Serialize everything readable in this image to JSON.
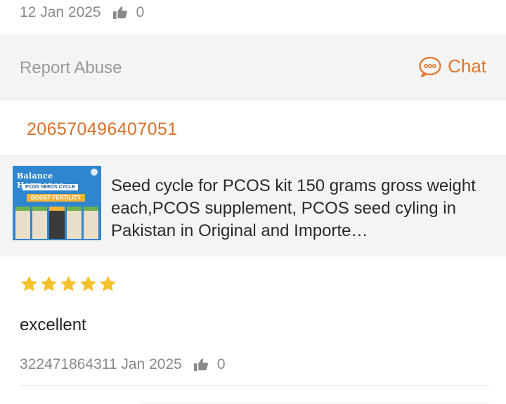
{
  "top_review": {
    "date": "12 Jan 2025",
    "likes": "0"
  },
  "actions": {
    "report_label": "Report Abuse",
    "chat_label": "Chat"
  },
  "order": {
    "id": "206570496407051"
  },
  "product": {
    "thumb_title": "Balance Hormones",
    "thumb_subtitle": "PCOS SEEDS CYCLE",
    "thumb_boost": "BOOST FERTILITY",
    "title": "Seed cycle for PCOS kit 150 grams gross weight each,PCOS supplement, PCOS seed cyling in Pakistan in Original and Importe…"
  },
  "review": {
    "rating": 5,
    "rating_max": 5,
    "text": "excellent",
    "meta": "322471864311 Jan 2025",
    "likes": "0"
  },
  "colors": {
    "accent": "#e0762a",
    "star": "#f6c12d",
    "muted": "#8a8a8a"
  }
}
